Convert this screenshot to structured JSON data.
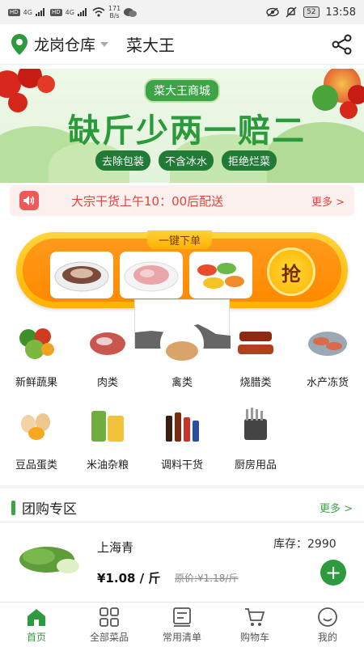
{
  "status_bar": {
    "sim1": "HD",
    "sim2": "HD",
    "network1": "4G",
    "network2": "4G",
    "speed_value": "171",
    "speed_unit": "B/s",
    "battery": "52",
    "time": "13:58"
  },
  "header": {
    "warehouse": "龙岗仓库",
    "shop_name": "菜大王"
  },
  "banner": {
    "tag": "菜大王商城",
    "title": "缺斤少两一赔二",
    "pills": [
      "去除包装",
      "不含冰水",
      "拒绝烂菜"
    ]
  },
  "notice": {
    "text": "大宗干货上午10：00后配送",
    "more": "更多 >"
  },
  "one_key_order": {
    "title": "一键下单",
    "grab": "抢"
  },
  "categories": [
    {
      "label": "新鲜蔬果",
      "icon": "vegetables-icon"
    },
    {
      "label": "肉类",
      "icon": "meat-icon"
    },
    {
      "label": "禽类",
      "icon": "poultry-icon"
    },
    {
      "label": "烧腊类",
      "icon": "roast-meat-icon"
    },
    {
      "label": "水产冻货",
      "icon": "seafood-icon"
    },
    {
      "label": "豆品蛋类",
      "icon": "eggs-icon"
    },
    {
      "label": "米油杂粮",
      "icon": "rice-oil-icon"
    },
    {
      "label": "调料干货",
      "icon": "seasoning-icon"
    },
    {
      "label": "厨房用品",
      "icon": "kitchenware-icon"
    }
  ],
  "group_buy": {
    "title": "团购专区",
    "more": "更多 >"
  },
  "product": {
    "name": "上海青",
    "stock": "库存：2990",
    "price": "¥1.08 / 斤",
    "original_price": "原价:¥1.18/斤"
  },
  "tabs": [
    {
      "label": "首页",
      "icon": "home-icon",
      "active": true
    },
    {
      "label": "全部菜品",
      "icon": "grid-icon",
      "active": false
    },
    {
      "label": "常用清单",
      "icon": "list-icon",
      "active": false
    },
    {
      "label": "购物车",
      "icon": "cart-icon",
      "active": false
    },
    {
      "label": "我的",
      "icon": "profile-icon",
      "active": false
    }
  ],
  "colors": {
    "brand_green": "#2e9a3e",
    "notice_red": "#e0443c",
    "order_orange": "#ff8a00"
  }
}
